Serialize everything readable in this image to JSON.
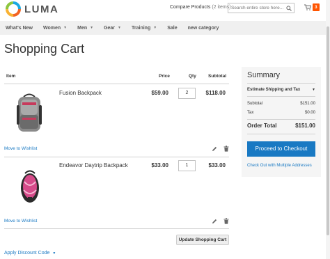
{
  "header": {
    "logo_text": "LUMA",
    "compare_label": "Compare Products",
    "compare_count": "(2 items)",
    "search_placeholder": "Search entire store here...",
    "cart_count": "3"
  },
  "nav": {
    "items": [
      {
        "label": "What's New",
        "has_caret": false
      },
      {
        "label": "Women",
        "has_caret": true
      },
      {
        "label": "Men",
        "has_caret": true
      },
      {
        "label": "Gear",
        "has_caret": true
      },
      {
        "label": "Training",
        "has_caret": true
      },
      {
        "label": "Sale",
        "has_caret": false
      },
      {
        "label": "new category",
        "has_caret": false
      }
    ]
  },
  "page_title": "Shopping Cart",
  "table": {
    "headers": {
      "item": "Item",
      "price": "Price",
      "qty": "Qty",
      "subtotal": "Subtotal"
    },
    "rows": [
      {
        "name": "Fusion Backpack",
        "price": "$59.00",
        "qty": "2",
        "subtotal": "$118.00",
        "wishlist": "Move to Wishlist",
        "colors": [
          "#7d7d7d",
          "#c73a5c"
        ]
      },
      {
        "name": "Endeavor Daytrip Backpack",
        "price": "$33.00",
        "qty": "1",
        "subtotal": "$33.00",
        "wishlist": "Move to Wishlist",
        "colors": [
          "#d64b8a",
          "#2b2b2b"
        ]
      }
    ]
  },
  "update_cart": "Update Shopping Cart",
  "discount": "Apply Discount Code",
  "summary": {
    "title": "Summary",
    "estimate": "Estimate Shipping and Tax",
    "subtotal_label": "Subtotal",
    "subtotal_value": "$151.00",
    "tax_label": "Tax",
    "tax_value": "$0.00",
    "total_label": "Order Total",
    "total_value": "$151.00",
    "checkout": "Proceed to Checkout",
    "multi": "Check Out with Multiple Addresses"
  },
  "colors": {
    "accent": "#1979c3",
    "cart_badge": "#ff5501",
    "nav_bg": "#f0f0f0",
    "summary_bg": "#f5f5f5"
  }
}
